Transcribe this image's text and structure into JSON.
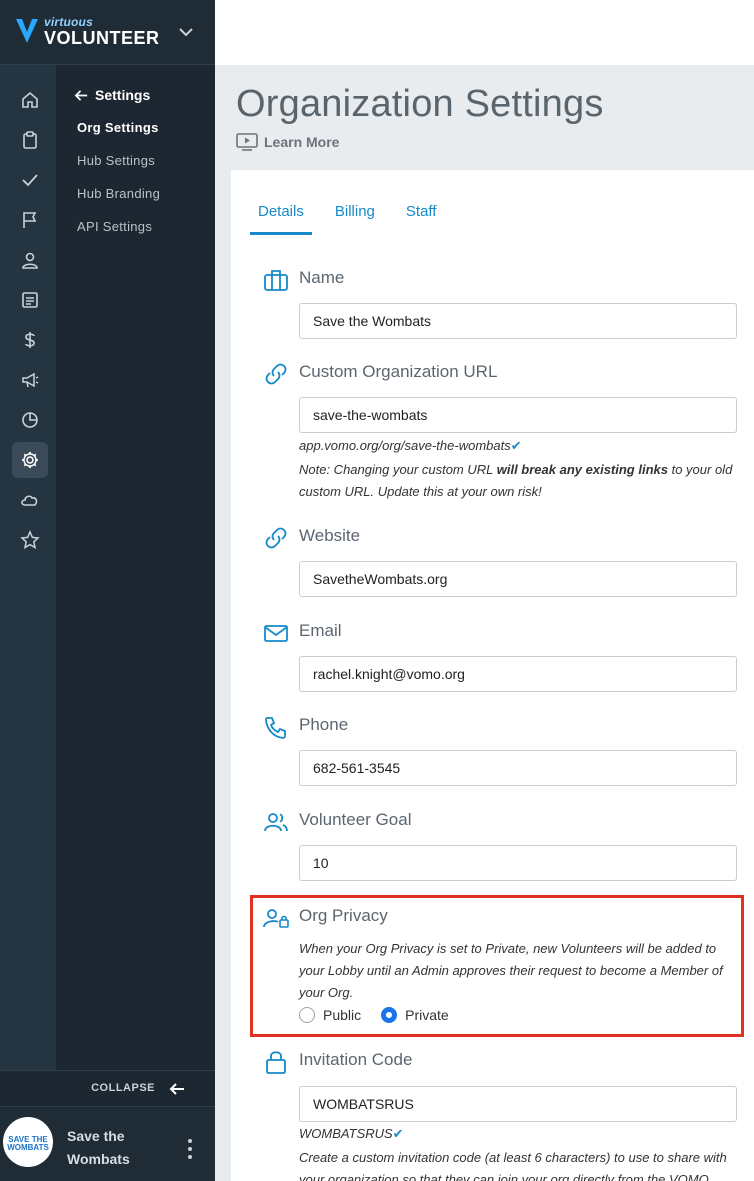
{
  "brand": {
    "small": "virtuous",
    "big": "VOLUNTEER"
  },
  "settings_nav": {
    "back_label": "Settings",
    "items": [
      {
        "label": "Org Settings",
        "active": true
      },
      {
        "label": "Hub Settings",
        "active": false
      },
      {
        "label": "Hub Branding",
        "active": false
      },
      {
        "label": "API Settings",
        "active": false
      }
    ]
  },
  "rail_icons": [
    "home-icon",
    "clipboard-icon",
    "check-icon",
    "flag-icon",
    "user-icon",
    "document-icon",
    "dollar-icon",
    "megaphone-icon",
    "pie-chart-icon",
    "gear-icon",
    "cloud-icon",
    "star-icon"
  ],
  "collapse_label": "COLLAPSE",
  "org": {
    "name": "Save the Wombats",
    "avatar_text": "SAVE THE WOMBATS"
  },
  "page": {
    "title": "Organization Settings",
    "learn_more": "Learn More"
  },
  "tabs": [
    {
      "label": "Details",
      "active": true
    },
    {
      "label": "Billing",
      "active": false
    },
    {
      "label": "Staff",
      "active": false
    }
  ],
  "fields": {
    "name": {
      "label": "Name",
      "value": "Save the Wombats"
    },
    "custom_url": {
      "label": "Custom Organization URL",
      "value": "save-the-wombats",
      "preview": "app.vomo.org/org/save-the-wombats",
      "note_prefix": "Note: Changing your custom URL ",
      "note_bold": "will break any existing links",
      "note_suffix": " to your old custom URL. Update this at your own risk!"
    },
    "website": {
      "label": "Website",
      "value": "SavetheWombats.org"
    },
    "email": {
      "label": "Email",
      "value": "rachel.knight@vomo.org"
    },
    "phone": {
      "label": "Phone",
      "value": "682-561-3545"
    },
    "volunteer_goal": {
      "label": "Volunteer Goal",
      "value": "10"
    },
    "org_privacy": {
      "label": "Org Privacy",
      "description": "When your Org Privacy is set to Private, new Volunteers will be added to your Lobby until an Admin approves their request to become a Member of your Org.",
      "options": [
        "Public",
        "Private"
      ],
      "selected": "Private"
    },
    "invitation_code": {
      "label": "Invitation Code",
      "value": "WOMBATSRUS",
      "preview": "WOMBATSRUS",
      "note": "Create a custom invitation code (at least 6 characters) to use to share with your organization so that they can join your org directly from the VOMO"
    }
  },
  "colors": {
    "accent": "#1689c9",
    "highlight": "#e0321f",
    "sidebar": "#1c2731"
  }
}
